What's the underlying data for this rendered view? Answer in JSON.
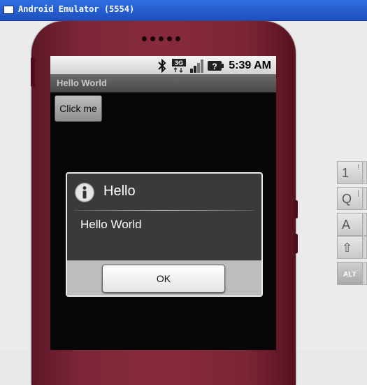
{
  "window": {
    "title": "Android Emulator (5554)"
  },
  "status_bar": {
    "time": "5:39 AM",
    "icons": [
      "bluetooth-icon",
      "3g-data-icon",
      "signal-strength-icon",
      "battery-unknown-icon"
    ],
    "network_label": "3G"
  },
  "app": {
    "title": "Hello World",
    "button_label": "Click me"
  },
  "dialog": {
    "icon": "info-icon",
    "title": "Hello",
    "message": "Hello World",
    "ok_label": "OK"
  },
  "keyboard": {
    "keys": [
      {
        "label": "1",
        "alt": "!"
      },
      {
        "label": "Q",
        "alt": "|"
      },
      {
        "label": "A",
        "alt": ""
      },
      {
        "label": "⇧",
        "alt": ""
      },
      {
        "label": "ALT",
        "alt": ""
      }
    ]
  },
  "colors": {
    "phone_body": "#872b3c",
    "titlebar": "#2f6fe0"
  }
}
